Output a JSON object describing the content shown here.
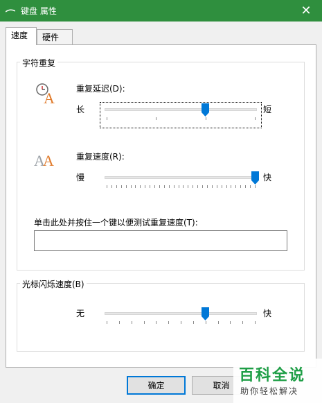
{
  "window": {
    "title": "键盘 属性",
    "close_glyph": "✕"
  },
  "tabs": [
    {
      "label": "速度",
      "active": true
    },
    {
      "label": "硬件",
      "active": false
    }
  ],
  "char_repeat": {
    "group_title": "字符重复",
    "delay": {
      "label": "重复延迟(D):",
      "left": "长",
      "right": "短",
      "level": 0.667,
      "tick_count": 4
    },
    "rate": {
      "label": "重复速度(R):",
      "left": "慢",
      "right": "快",
      "level": 1.0,
      "tick_count": 32
    },
    "test_label": "单击此处并按住一个键以便测试重复速度(T):",
    "test_value": ""
  },
  "cursor_blink": {
    "group_title": "光标闪烁速度(B)",
    "left": "无",
    "right": "快",
    "level": 0.667,
    "tick_count": 13
  },
  "buttons": {
    "ok": "确定",
    "cancel": "取消"
  },
  "watermark": {
    "big": "百科全说",
    "small": "助你轻松解决"
  },
  "colors": {
    "titlebar": "#2f8f3e",
    "thumb": "#0078d7",
    "watermark_green": "#1e9e46"
  }
}
